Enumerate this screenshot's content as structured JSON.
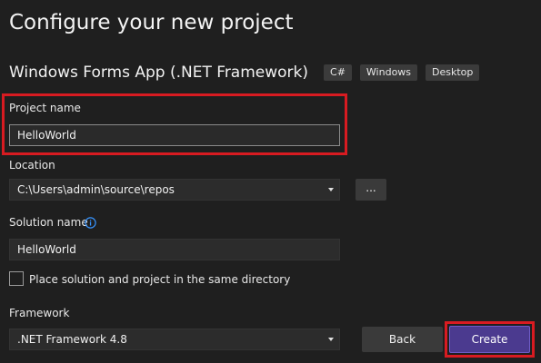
{
  "header": {
    "title": "Configure your new project"
  },
  "template": {
    "name": "Windows Forms App (.NET Framework)",
    "tags": [
      "C#",
      "Windows",
      "Desktop"
    ]
  },
  "project_name": {
    "label": "Project name",
    "value": "HelloWorld"
  },
  "location": {
    "label": "Location",
    "value": "C:\\Users\\admin\\source\\repos",
    "browse_label": "..."
  },
  "solution_name": {
    "label": "Solution name",
    "value": "HelloWorld",
    "info_icon": "info-icon"
  },
  "same_directory": {
    "label": "Place solution and project in the same directory",
    "checked": false
  },
  "framework": {
    "label": "Framework",
    "value": ".NET Framework 4.8"
  },
  "footer": {
    "back_label": "Back",
    "create_label": "Create"
  },
  "colors": {
    "background": "#1f1f1f",
    "highlight": "#d81b21",
    "accent": "#4b3a8f",
    "info": "#3794ff"
  }
}
